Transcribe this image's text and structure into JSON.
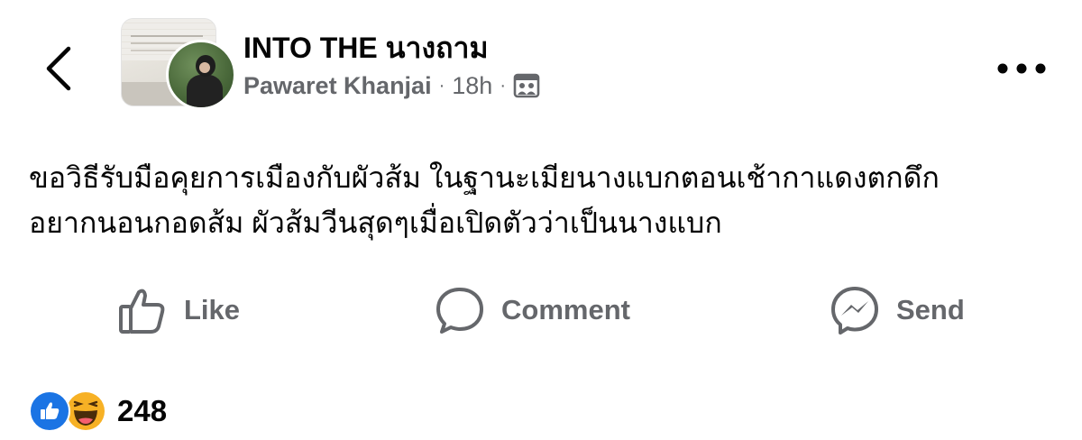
{
  "header": {
    "group_name": "INTO THE นางถาม",
    "author": "Pawaret Khanjai",
    "separator": "·",
    "time": "18h",
    "audience_icon": "photo-album-icon",
    "back_icon": "chevron-left-icon",
    "more_icon": "more-dots-icon"
  },
  "post": {
    "text": "ขอวิธีรับมือคุยการเมืองกับผัวส้ม ในฐานะเมียนางแบกตอนเช้ากาแดงตกดึก\nอยากนอนกอดส้ม ผัวส้มวีนสุดๆเมื่อเปิดตัวว่าเป็นนางแบก"
  },
  "actions": {
    "like_label": "Like",
    "comment_label": "Comment",
    "send_label": "Send"
  },
  "reactions": {
    "types": [
      "like-reaction-icon",
      "haha-reaction-icon"
    ],
    "count": "248"
  },
  "colors": {
    "text": "#050505",
    "muted": "#65676b",
    "like_blue": "#1b74e4",
    "haha_yellow": "#f7b125"
  }
}
